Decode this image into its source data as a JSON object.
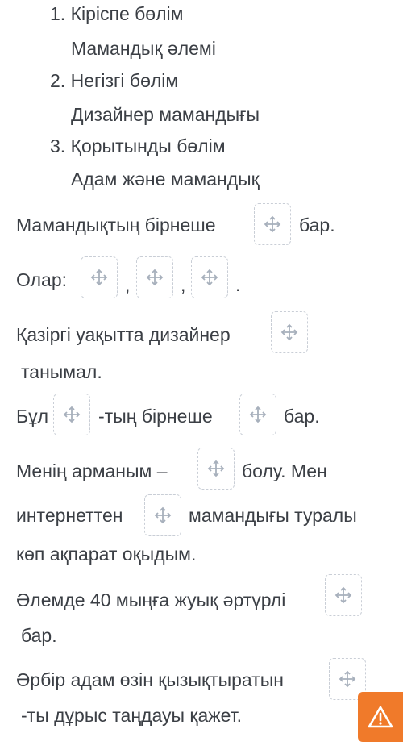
{
  "outline": [
    {
      "num": "1.",
      "title": "Кіріспе бөлім",
      "sub": "Мамандық әлемі"
    },
    {
      "num": "2.",
      "title": "Негізгі бөлім",
      "sub": "Дизайнер мамандығы"
    },
    {
      "num": "3.",
      "title": "Қорытынды бөлім",
      "sub": "Адам және мамандық"
    }
  ],
  "sentences": {
    "s1": {
      "before": "Мамандықтың бірнеше",
      "after": "бар."
    },
    "s2": {
      "before": "Олар:",
      "sep1": ",",
      "sep2": ",",
      "end": "."
    },
    "s3": {
      "before": "Қазіргі уақытта дизайнер",
      "line2": "танымал."
    },
    "s4": {
      "before": "Бұл",
      "mid": "-тың бірнеше",
      "after": "бар."
    },
    "s5": {
      "before": "Менің арманым –",
      "after": "болу. Мен",
      "line2_before": "интернеттен",
      "line2_after": "мамандығы туралы",
      "line3": "көп ақпарат оқыдым."
    },
    "s6": {
      "before": "Әлемде 40 мыңға жуық әртүрлі",
      "line2": "бар."
    },
    "s7": {
      "before": "Әрбір адам өзін қызықтыратын",
      "line2": "-ты дұрыс таңдауы қажет."
    }
  },
  "icons": {
    "slot": "move-crosshair-icon",
    "alert": "warning-triangle-icon"
  },
  "colors": {
    "text": "#3b3f45",
    "slot_border": "#c9ced6",
    "slot_icon": "#a7b0bc",
    "alert": "#f07a2a"
  }
}
